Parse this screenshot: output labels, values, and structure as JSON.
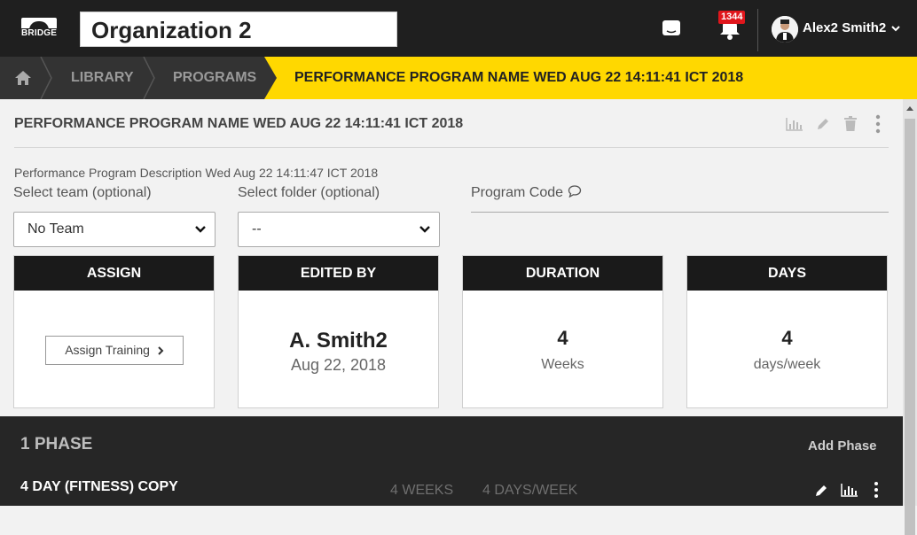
{
  "topbar": {
    "logo_text": "BRIDGE",
    "organization": "Organization 2",
    "notification_count": "1344",
    "user_name": "Alex2 Smith2"
  },
  "breadcrumb": {
    "items": [
      "LIBRARY",
      "PROGRAMS"
    ],
    "active": "PERFORMANCE PROGRAM NAME WED AUG 22 14:11:41 ICT 2018"
  },
  "program": {
    "title": "PERFORMANCE PROGRAM NAME WED AUG 22 14:11:41 ICT 2018",
    "description": "Performance Program Description Wed Aug 22 14:11:47 ICT 2018",
    "team_label": "Select team (optional)",
    "team_value": "No Team",
    "folder_label": "Select folder (optional)",
    "folder_value": "--",
    "code_label": "Program Code"
  },
  "cards": {
    "assign": {
      "header": "ASSIGN",
      "button": "Assign Training"
    },
    "edited": {
      "header": "EDITED BY",
      "name": "A. Smith2",
      "date": "Aug 22, 2018"
    },
    "duration": {
      "header": "DURATION",
      "value": "4",
      "unit": "Weeks"
    },
    "days": {
      "header": "DAYS",
      "value": "4",
      "unit": "days/week"
    }
  },
  "phases": {
    "title": "1 PHASE",
    "add_label": "Add Phase",
    "items": [
      {
        "name": "4 DAY (FITNESS) COPY",
        "weeks": "4  WEEKS",
        "days": "4  DAYS/WEEK"
      }
    ]
  },
  "colors": {
    "accent": "#ffd800",
    "topbar": "#1f1f1f",
    "badge": "#e0161c"
  }
}
